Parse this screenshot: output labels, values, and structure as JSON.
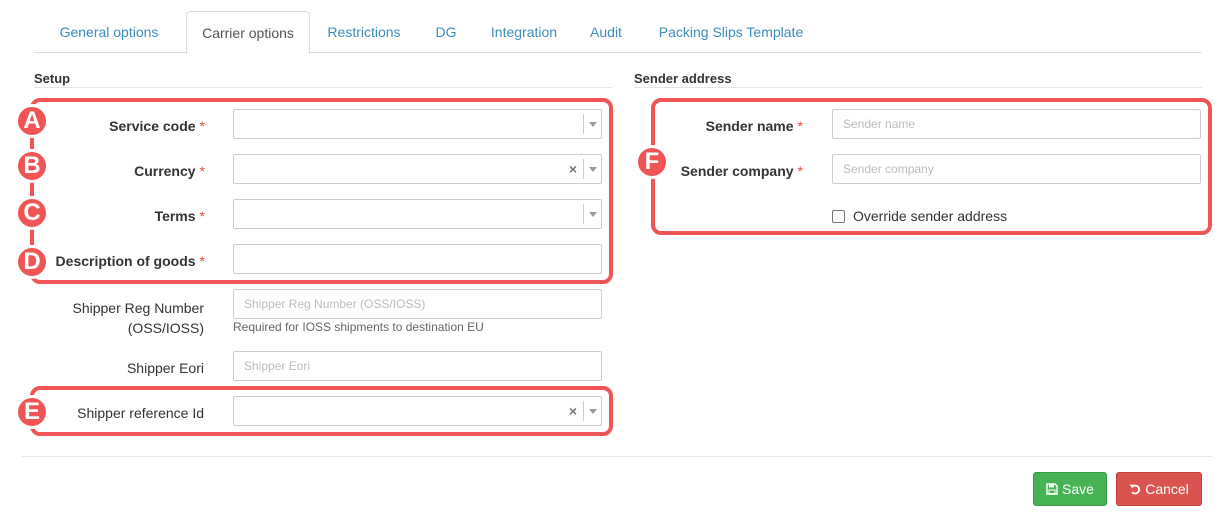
{
  "tabs": [
    {
      "label": "General options"
    },
    {
      "label": "Carrier options"
    },
    {
      "label": "Restrictions"
    },
    {
      "label": "DG"
    },
    {
      "label": "Integration"
    },
    {
      "label": "Audit"
    },
    {
      "label": "Packing Slips Template"
    }
  ],
  "active_tab": "Carrier options",
  "setup": {
    "title": "Setup",
    "service_code": {
      "label": "Service code",
      "required": "*",
      "value": ""
    },
    "currency": {
      "label": "Currency",
      "required": "*",
      "value": "",
      "clear": "×"
    },
    "terms": {
      "label": "Terms",
      "required": "*",
      "value": ""
    },
    "description": {
      "label": "Description of goods",
      "required": "*",
      "value": ""
    },
    "shipper_reg": {
      "label_line1": "Shipper Reg Number",
      "label_line2": "(OSS/IOSS)",
      "placeholder": "Shipper Reg Number (OSS/IOSS)",
      "help": "Required for IOSS shipments to destination EU"
    },
    "shipper_eori": {
      "label": "Shipper Eori",
      "placeholder": "Shipper Eori"
    },
    "shipper_ref": {
      "label": "Shipper reference Id",
      "value": "",
      "clear": "×"
    }
  },
  "sender": {
    "title": "Sender address",
    "name": {
      "label": "Sender name",
      "required": "*",
      "placeholder": "Sender name"
    },
    "company": {
      "label": "Sender company",
      "required": "*",
      "placeholder": "Sender company"
    },
    "override": {
      "label": "Override sender address",
      "checked": false
    }
  },
  "annotations": [
    "A",
    "B",
    "C",
    "D",
    "E",
    "F"
  ],
  "buttons": {
    "save": "Save",
    "cancel": "Cancel"
  },
  "colors": {
    "link": "#3c8dbc",
    "annotation": "#f05555",
    "required": "#dd4b39",
    "save": "#47b355",
    "cancel": "#d9534f"
  },
  "icons": {
    "save": "floppy-disk-icon",
    "cancel": "undo-icon"
  }
}
